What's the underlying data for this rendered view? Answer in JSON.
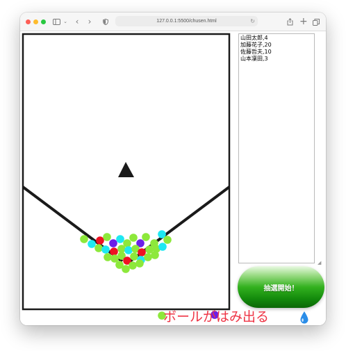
{
  "browser": {
    "url": "127.0.0.1:5500/chusen.html",
    "colors": {
      "close": "#fe5f57",
      "minimize": "#febc2e",
      "zoom": "#28c840"
    },
    "icons": [
      "sidebar-icon",
      "chevron-down-icon",
      "back-icon",
      "forward-icon",
      "shield-icon",
      "reload-icon",
      "share-icon",
      "new-tab-icon",
      "tabs-overview-icon"
    ]
  },
  "participants": {
    "text": "山田太郎,4\n加藤花子,20\n佐藤哲夫,10\n山本凜田,3"
  },
  "start_button": {
    "label": "抽選開始！"
  },
  "caption": {
    "text": "ボールがはみ出る"
  },
  "arena": {
    "colors": {
      "frame": "#1a1a1a",
      "ball_green": "#8de83b",
      "ball_cyan": "#1ee8f2",
      "ball_red": "#ee1122",
      "ball_purple": "#6a1fe8",
      "drop": "#2a8de8"
    }
  }
}
